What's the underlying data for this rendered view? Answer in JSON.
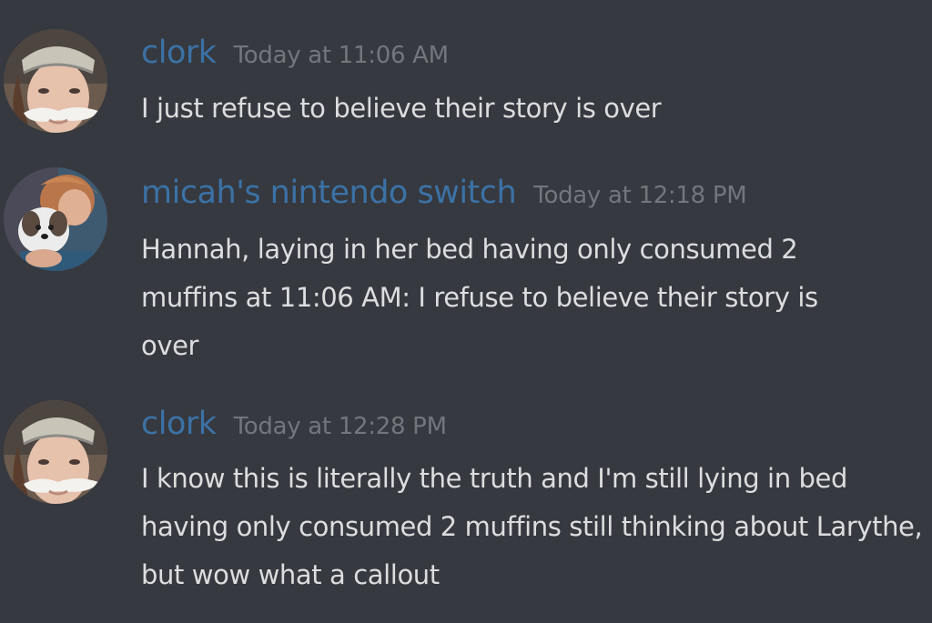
{
  "messages": [
    {
      "author": "clork",
      "timestamp": "Today at 11:06 AM",
      "text": "I just refuse to believe their story is over",
      "avatar_icon": "person-with-mustache-avatar"
    },
    {
      "author": "micah's nintendo switch",
      "timestamp": "Today at 12:18 PM",
      "text": "Hannah, laying in her bed having only consumed 2 muffins at 11:06 AM: I refuse to believe their story is over",
      "avatar_icon": "person-with-dog-avatar"
    },
    {
      "author": "clork",
      "timestamp": "Today at 12:28 PM",
      "text": "I know this is literally the truth and I'm still lying in bed having only consumed 2 muffins still thinking about Larythe, but wow what a callout",
      "avatar_icon": "person-with-mustache-avatar"
    }
  ],
  "colors": {
    "background": "#36393f",
    "username": "#3b72a6",
    "timestamp": "#72767d",
    "message_text": "#dcddde"
  }
}
